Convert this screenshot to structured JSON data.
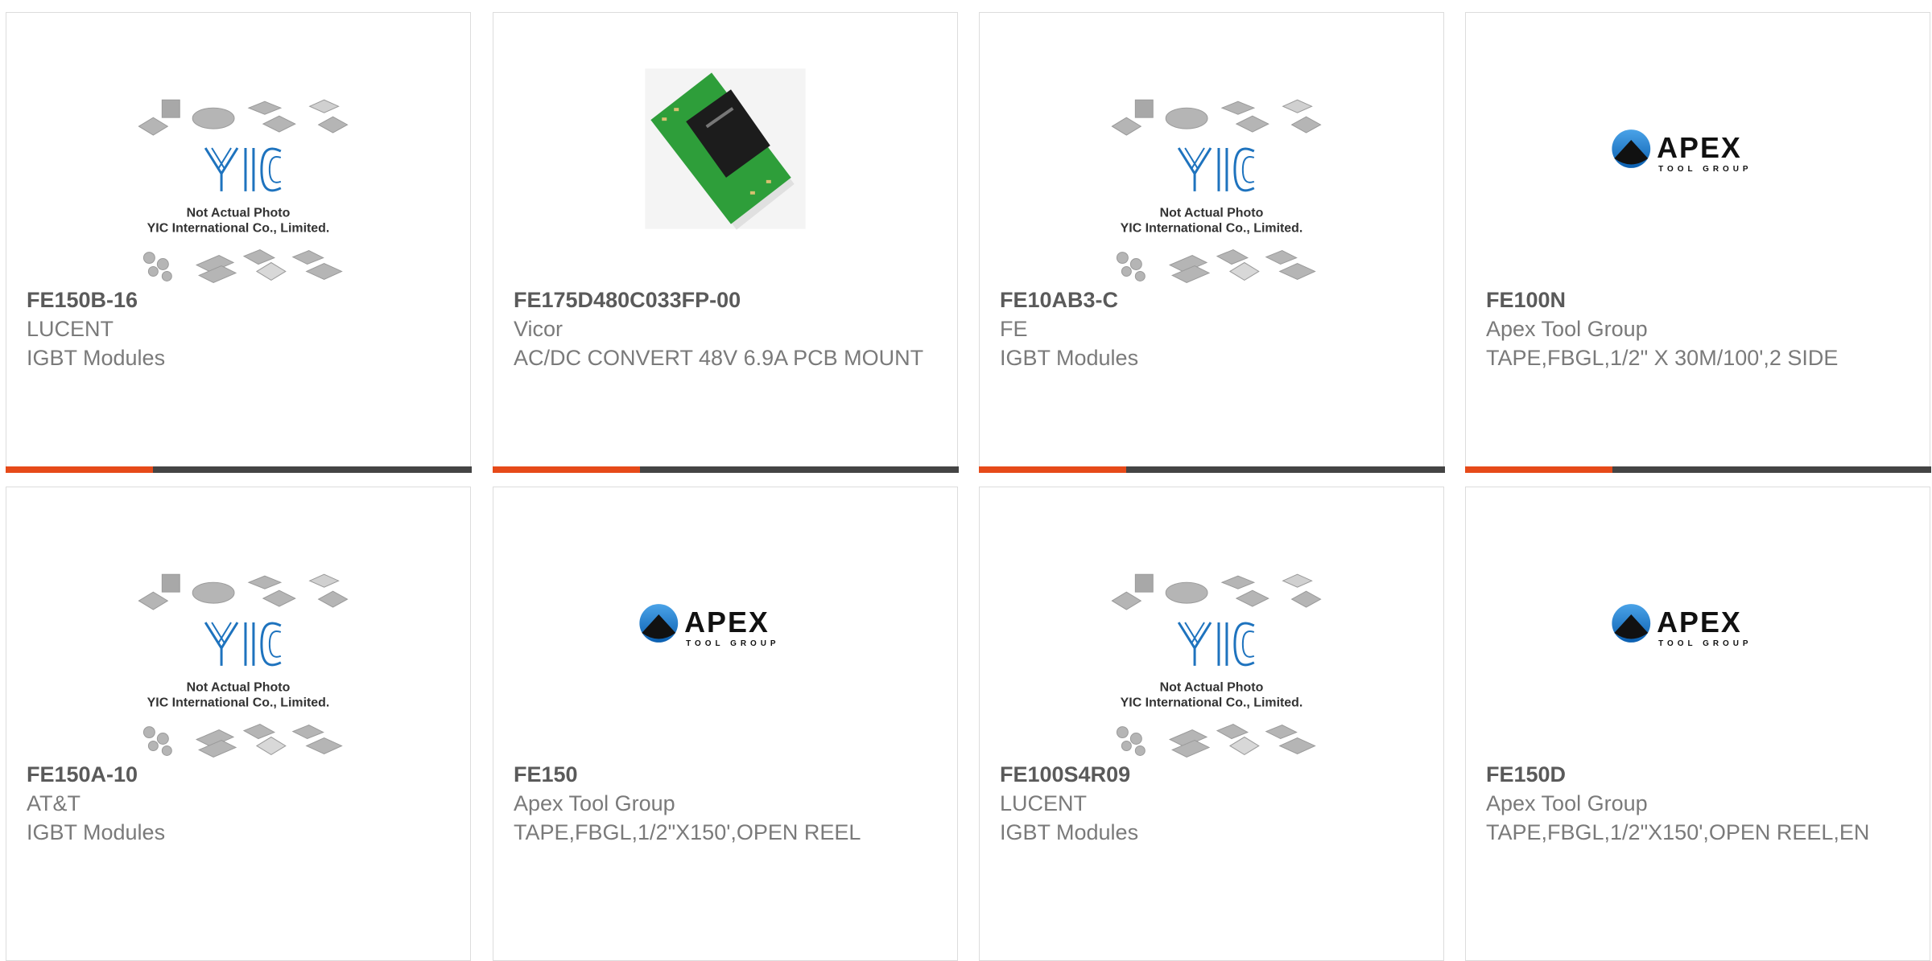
{
  "products": [
    {
      "part": "FE150B-16",
      "brand": "LUCENT",
      "desc": "IGBT Modules",
      "image": "yic-placeholder",
      "placeholder_line1": "Not Actual Photo",
      "placeholder_line2": "YIC International Co., Limited."
    },
    {
      "part": "FE175D480C033FP-00",
      "brand": "Vicor",
      "desc": "AC/DC CONVERT 48V 6.9A PCB MOUNT",
      "image": "vicor-module"
    },
    {
      "part": "FE10AB3-C",
      "brand": "FE",
      "desc": "IGBT Modules",
      "image": "yic-placeholder",
      "placeholder_line1": "Not Actual Photo",
      "placeholder_line2": "YIC International Co., Limited."
    },
    {
      "part": "FE100N",
      "brand": "Apex Tool Group",
      "desc": "TAPE,FBGL,1/2\" X 30M/100',2 SIDE",
      "image": "apex-logo",
      "logo_text": "APEX",
      "logo_sub": "TOOL GROUP"
    },
    {
      "part": "FE150A-10",
      "brand": "AT&T",
      "desc": "IGBT Modules",
      "image": "yic-placeholder",
      "placeholder_line1": "Not Actual Photo",
      "placeholder_line2": "YIC International Co., Limited."
    },
    {
      "part": "FE150",
      "brand": "Apex Tool Group",
      "desc": "TAPE,FBGL,1/2\"X150',OPEN REEL",
      "image": "apex-logo",
      "logo_text": "APEX",
      "logo_sub": "TOOL GROUP"
    },
    {
      "part": "FE100S4R09",
      "brand": "LUCENT",
      "desc": "IGBT Modules",
      "image": "yic-placeholder",
      "placeholder_line1": "Not Actual Photo",
      "placeholder_line2": "YIC International Co., Limited."
    },
    {
      "part": "FE150D",
      "brand": "Apex Tool Group",
      "desc": "TAPE,FBGL,1/2\"X150',OPEN REEL,EN",
      "image": "apex-logo",
      "logo_text": "APEX",
      "logo_sub": "TOOL GROUP"
    }
  ],
  "colors": {
    "accent": "#e64a19",
    "bar": "#444444",
    "yic_blue": "#1e73be",
    "pcb_green": "#2e9e3a"
  }
}
